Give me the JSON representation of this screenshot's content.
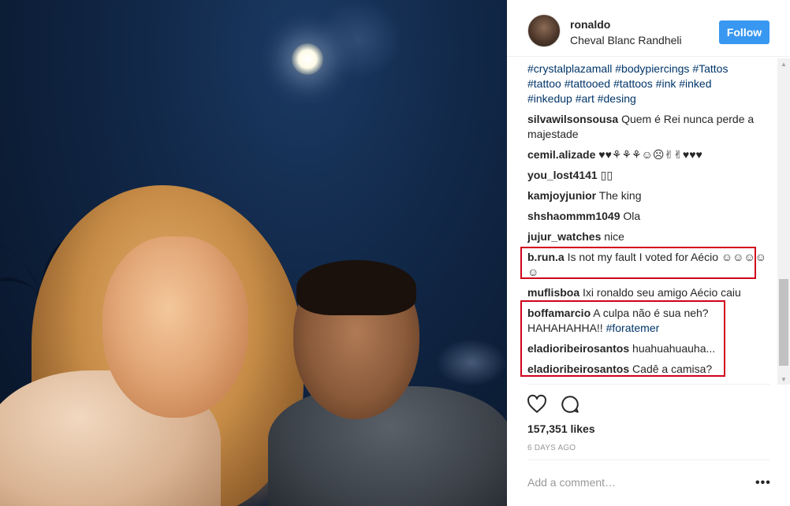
{
  "post": {
    "username": "ronaldo",
    "location": "Cheval Blanc Randheli",
    "follow_label": "Follow"
  },
  "caption_tags": [
    "#crystalplazamall #bodypiercings #Tattos",
    "#tattoo #tattooed #tattoos #ink #inked",
    "#inkedup #art #desing"
  ],
  "comments": [
    {
      "user": "silvawilsonsousa",
      "text": "Quem é Rei nunca perde a majestade",
      "tag": ""
    },
    {
      "user": "cemil.alizade",
      "text": "♥♥⚘⚘⚘☺☹✌✌♥♥♥",
      "tag": ""
    },
    {
      "user": "you_lost4141",
      "text": "▯▯",
      "tag": ""
    },
    {
      "user": "kamjoyjunior",
      "text": "The king",
      "tag": ""
    },
    {
      "user": "shshaommm1049",
      "text": "Ola",
      "tag": ""
    },
    {
      "user": "jujur_watches",
      "text": "nice",
      "tag": ""
    },
    {
      "user": "b.run.a",
      "text": "Is not my fault I voted for Aécio ☺☺☺☺☺",
      "tag": ""
    },
    {
      "user": "muflisboa",
      "text": "Ixi ronaldo seu amigo Aécio caiu",
      "tag": ""
    },
    {
      "user": "boffamarcio",
      "text": "A culpa não é sua neh? HAHAHAHHA!!",
      "tag": "#foratemer"
    },
    {
      "user": "eladioribeirosantos",
      "text": "huahuahuauha...",
      "tag": ""
    },
    {
      "user": "eladioribeirosantos",
      "text": "Cadê a camisa?",
      "tag": ""
    }
  ],
  "likes": "157,351 likes",
  "time_ago": "6 DAYS AGO",
  "add_comment_placeholder": "Add a comment…",
  "more_options": "•••",
  "scroll_up_glyph": "▲",
  "scroll_down_glyph": "▼",
  "colors": {
    "follow_button": "#3897f0",
    "hashtag": "#003569",
    "highlight": "#d0021b"
  },
  "icons": {
    "like": "heart-icon",
    "comment": "comment-bubble-icon",
    "more": "more-options-icon"
  }
}
